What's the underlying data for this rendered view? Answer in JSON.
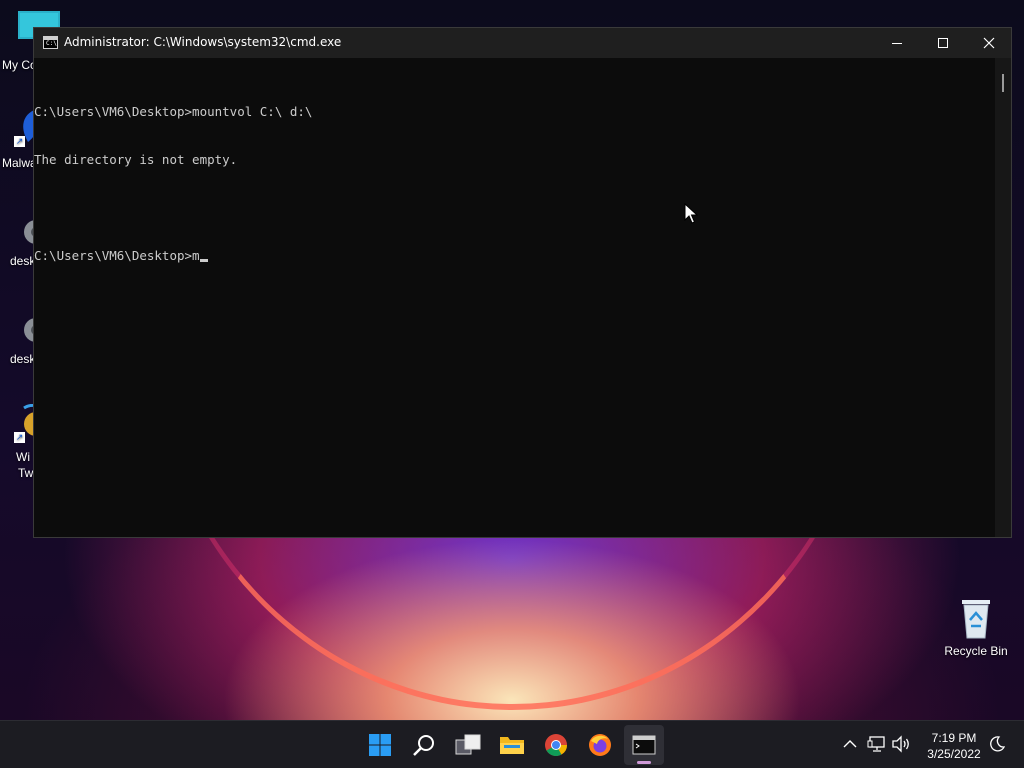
{
  "window": {
    "title": "Administrator: C:\\Windows\\system32\\cmd.exe",
    "icon_text": "C:\\"
  },
  "console": {
    "lines": [
      "C:\\Users\\VM6\\Desktop>mountvol C:\\ d:\\",
      "The directory is not empty.",
      "",
      "C:\\Users\\VM6\\Desktop>m"
    ]
  },
  "desktop": {
    "icons": [
      {
        "label": "My Co"
      },
      {
        "label": "Malwa"
      },
      {
        "label": "desk"
      },
      {
        "label": "desk"
      },
      {
        "label": "Wi",
        "label2": "Tw"
      }
    ],
    "recycle_bin": {
      "label": "Recycle Bin"
    }
  },
  "taskbar": {
    "time": "7:19 PM",
    "date": "3/25/2022"
  },
  "colors": {
    "console_bg": "#0c0c0c",
    "console_text": "#cccccc",
    "titlebar_bg": "#1f1f1f",
    "taskbar_bg": "#1c1c22"
  }
}
